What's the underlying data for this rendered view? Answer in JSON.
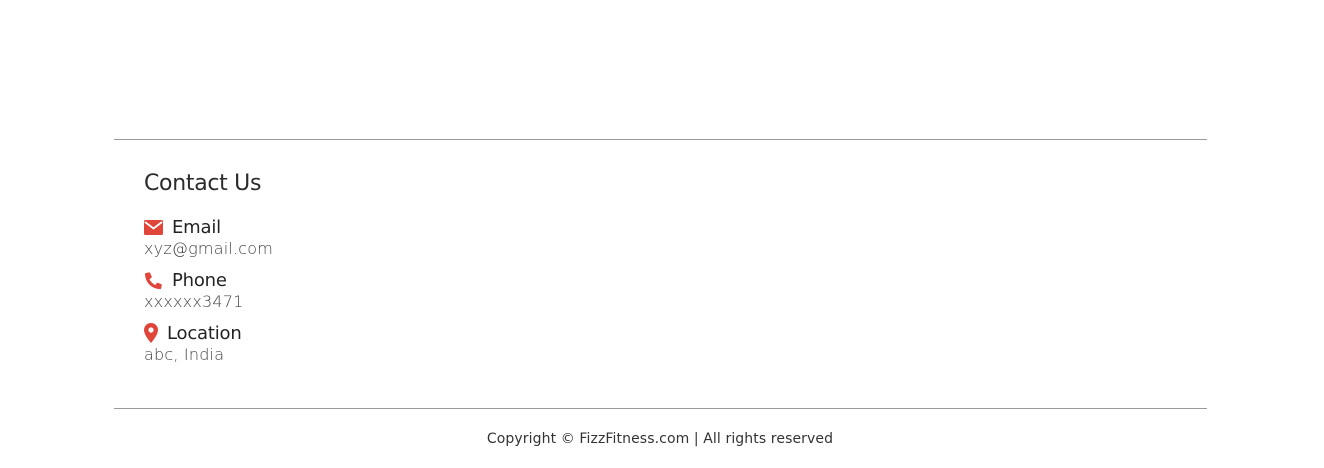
{
  "contact": {
    "title": "Contact Us",
    "accent_color": "#e0453a",
    "items": [
      {
        "icon": "envelope-icon",
        "label": "Email",
        "value": "xyz@gmail.com"
      },
      {
        "icon": "phone-icon",
        "label": "Phone",
        "value": "xxxxxx3471"
      },
      {
        "icon": "map-marker-icon",
        "label": "Location",
        "value": "abc, India"
      }
    ]
  },
  "footer": {
    "copyright": "Copyright © FizzFitness.com | All rights reserved"
  }
}
